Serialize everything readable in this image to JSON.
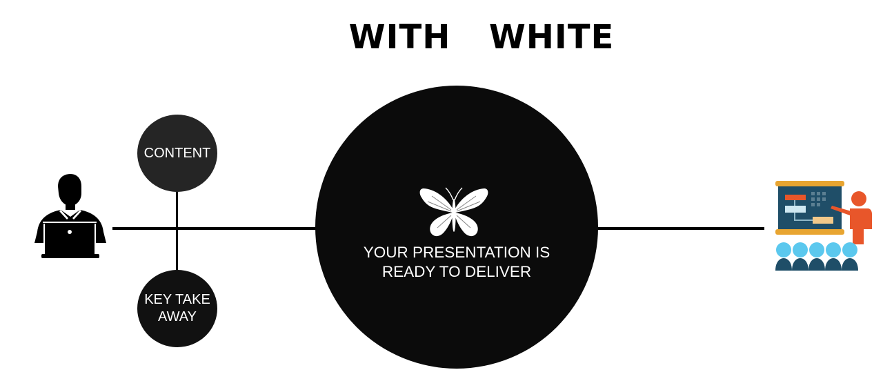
{
  "title": "WITH  WHITE",
  "nodes": {
    "content": "CONTENT",
    "key_takeaway": "KEY TAKE\nAWAY",
    "center": "YOUR PRESENTATION IS\nREADY TO DELIVER"
  },
  "colors": {
    "background": "#ffffff",
    "line": "#000000",
    "content_circle": "#252525",
    "key_takeaway_circle": "#111111",
    "center_circle": "#0b0b0b",
    "board": "#1f4e68",
    "board_frame": "#e8a531",
    "presenter": "#e8562a",
    "audience_heads": "#5bc8ee",
    "audience_bodies": "#1f4e68"
  },
  "icons": {
    "left": "person-laptop-icon",
    "center": "butterfly-icon",
    "right": "presenter-audience-icon"
  }
}
